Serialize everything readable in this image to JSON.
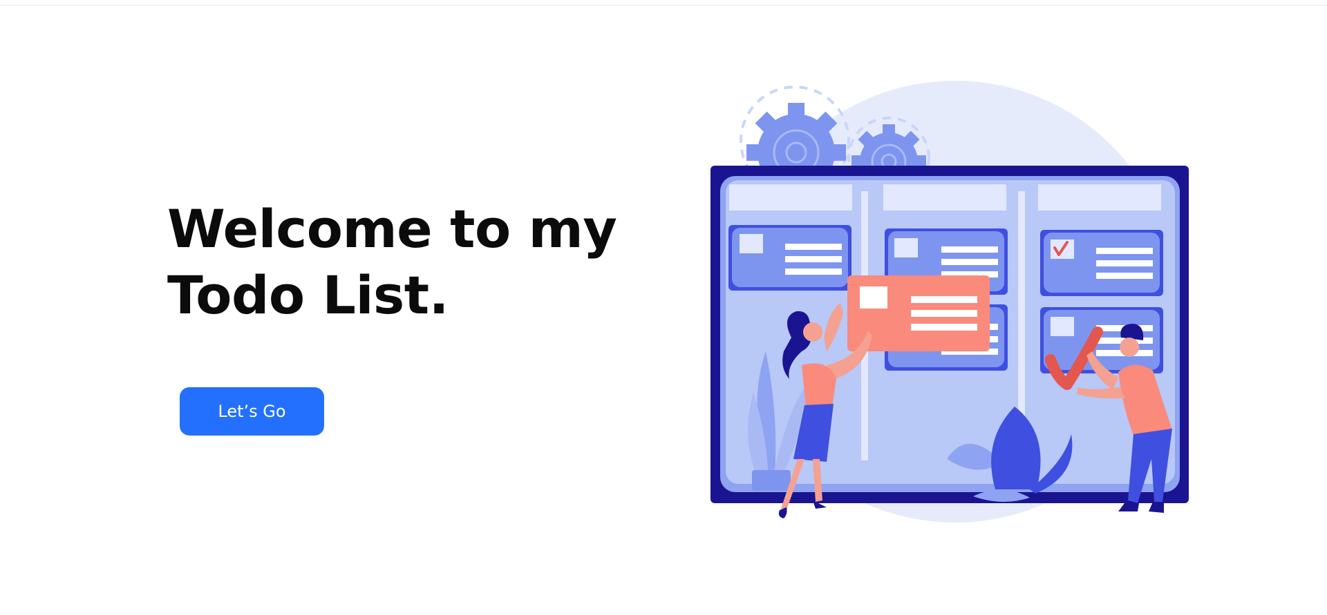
{
  "hero": {
    "title_line1": "Welcome to my",
    "title_line2": "Todo List.",
    "cta_label": "Let’s Go"
  },
  "illustration": {
    "icon": "kanban-board-illustration"
  },
  "colors": {
    "accent": "#2370ff",
    "board_frame": "#1b1491",
    "board_surface": "#b8c8f7",
    "card": "#7e95ef",
    "highlight_card": "#fa8a7c",
    "check": "#e3574f",
    "blob": "#e6ebfc"
  }
}
